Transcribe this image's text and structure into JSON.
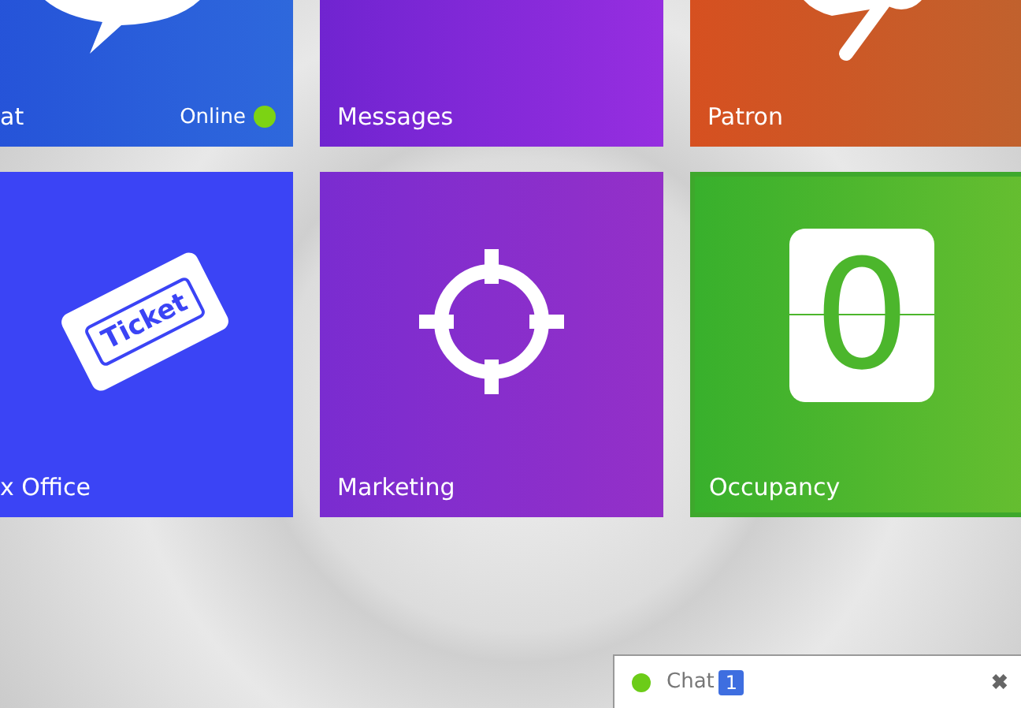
{
  "tiles": [
    {
      "kind": "chat",
      "label": "at",
      "status": "Online",
      "online": true,
      "selected": false
    },
    {
      "kind": "messages",
      "label": "Messages",
      "selected": false
    },
    {
      "kind": "patron",
      "label": "Patron",
      "selected": false
    },
    {
      "kind": "ticket",
      "label": "x Office",
      "icon_text": "Ticket",
      "selected": false
    },
    {
      "kind": "marketing",
      "label": "Marketing",
      "selected": false
    },
    {
      "kind": "occupancy",
      "label": "Occupancy",
      "counter": "0",
      "selected": true
    }
  ],
  "chat_bar": {
    "online": true,
    "label": "Chat",
    "count": "1",
    "close": "✖"
  }
}
